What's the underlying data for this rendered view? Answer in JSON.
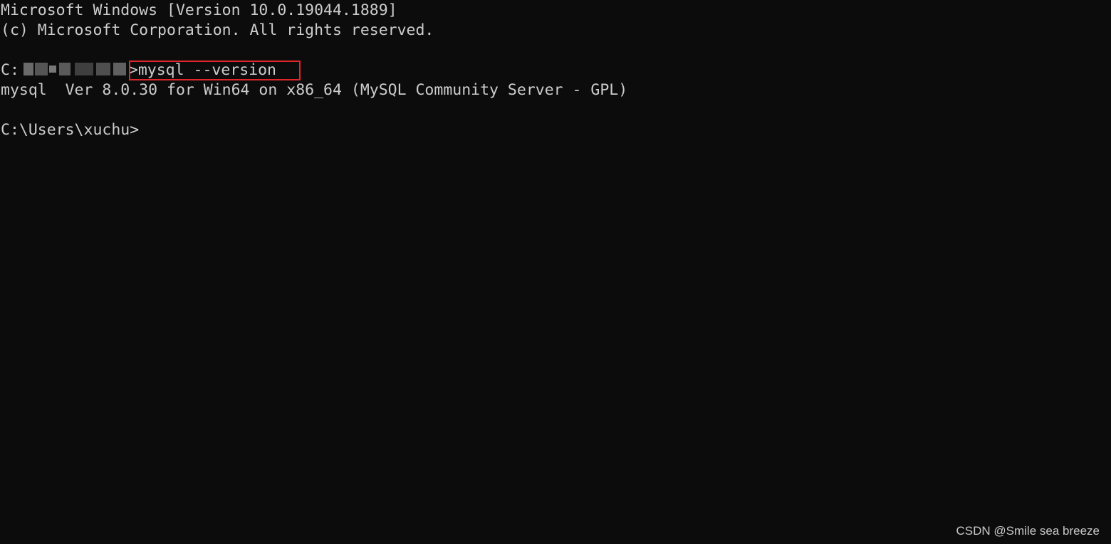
{
  "console": {
    "header_line1": "Microsoft Windows [Version 10.0.19044.1889]",
    "header_line2": "(c) Microsoft Corporation. All rights reserved.",
    "prompt1_prefix": "C:",
    "prompt1_suffix": ">",
    "command": "mysql --version",
    "output": "mysql  Ver 8.0.30 for Win64 on x86_64 (MySQL Community Server - GPL)",
    "prompt2": "C:\\Users\\xuchu>"
  },
  "watermark": "CSDN @Smile sea breeze",
  "colors": {
    "background": "#0c0c0c",
    "foreground": "#cccccc",
    "highlight_border": "#e0262b"
  }
}
